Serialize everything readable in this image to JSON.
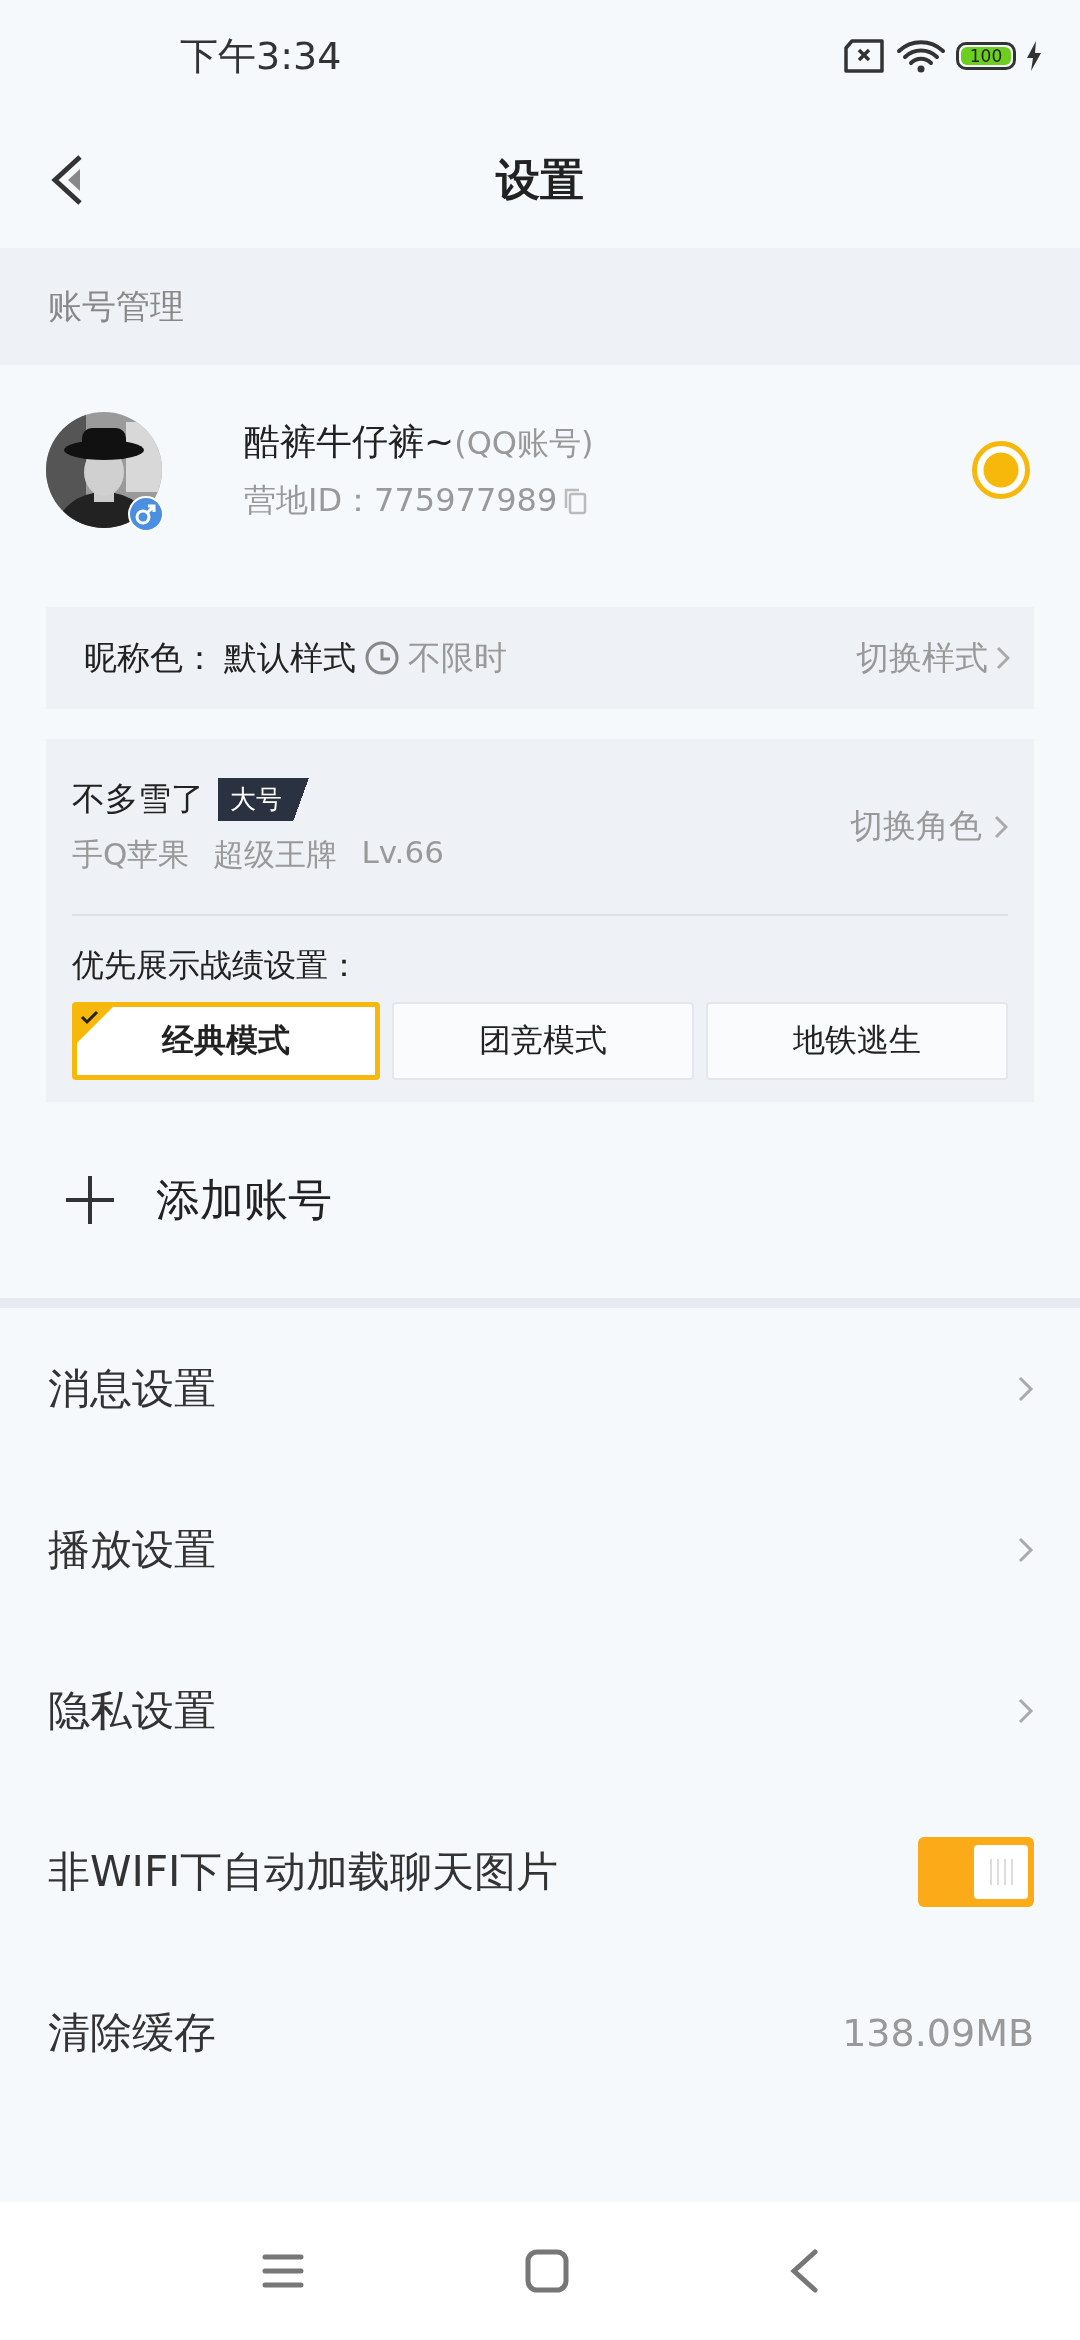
{
  "status_bar": {
    "time": "下午3:34",
    "battery": "100"
  },
  "header": {
    "title": "设置"
  },
  "account_section": {
    "title": "账号管理"
  },
  "account": {
    "name": "酷裤牛仔裤~",
    "name_suffix": "(QQ账号)",
    "id_label": "营地ID：",
    "id": "775977989",
    "selected": true
  },
  "nickname_color": {
    "label": "昵称色：",
    "value": "默认样式",
    "duration": "不限时",
    "action": "切换样式"
  },
  "role": {
    "name": "不多雪了",
    "badge": "大号",
    "details": [
      "手Q苹果",
      "超级王牌",
      "Lv.66"
    ],
    "action": "切换角色",
    "mode_label": "优先展示战绩设置：",
    "modes": [
      {
        "label": "经典模式",
        "selected": true
      },
      {
        "label": "团竞模式",
        "selected": false
      },
      {
        "label": "地铁逃生",
        "selected": false
      }
    ]
  },
  "add_account": {
    "label": "添加账号"
  },
  "settings": [
    {
      "kind": "link",
      "label": "消息设置"
    },
    {
      "kind": "link",
      "label": "播放设置"
    },
    {
      "kind": "link",
      "label": "隐私设置"
    },
    {
      "kind": "toggle",
      "label": "非WIFI下自动加载聊天图片",
      "on": true
    },
    {
      "kind": "value",
      "label": "清除缓存",
      "value": "138.09MB"
    }
  ]
}
